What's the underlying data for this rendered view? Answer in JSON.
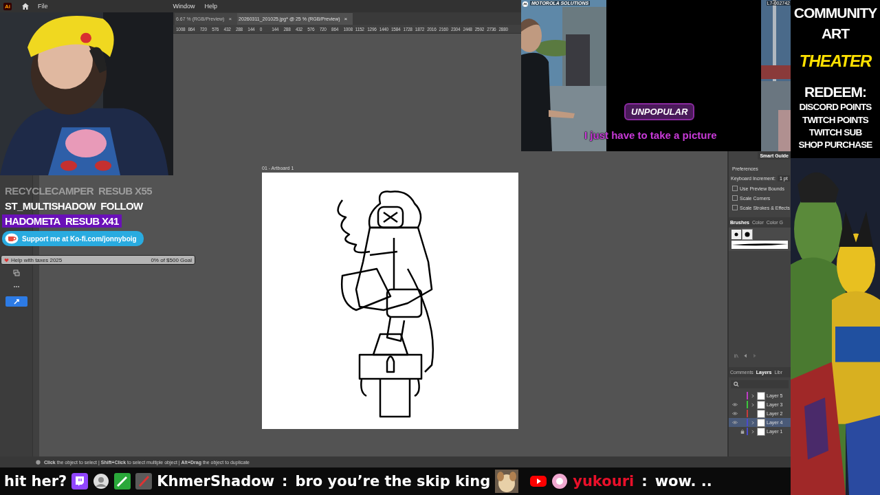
{
  "app": {
    "logo": "Ai",
    "menu": [
      "File",
      "Window",
      "Help"
    ]
  },
  "tabs": [
    {
      "label": "6.67 % (RGB/Preview)",
      "close": "×",
      "selected": false
    },
    {
      "label": "20260311_201025.jpg* @ 25 % (RGB/Preview)",
      "close": "×",
      "selected": true
    }
  ],
  "ruler": [
    "1008",
    "864",
    "720",
    "576",
    "432",
    "288",
    "144",
    "0",
    "144",
    "288",
    "432",
    "576",
    "720",
    "864",
    "1008",
    "1152",
    "1296",
    "1440",
    "1584",
    "1728",
    "1872",
    "2016",
    "2160",
    "2304",
    "2448",
    "2592",
    "2736",
    "2880"
  ],
  "artboard": {
    "label": "01 - Artboard 1"
  },
  "status_bar": {
    "text": "**Click** the object to select  |  **Shift+Click** to select multiple object  |  **Alt+Drag** the object to duplicate"
  },
  "properties": {
    "smart_guides": "Smart Guide",
    "section": "Preferences",
    "increment_label": "Keyboard Increment:",
    "increment_value": "1 pt",
    "options": [
      {
        "label": "Use Preview Bounds",
        "checked": false
      },
      {
        "label": "Scale Corners",
        "checked": false
      },
      {
        "label": "Scale Strokes & Effects",
        "checked": false
      }
    ]
  },
  "brush_tabs": [
    {
      "label": "Brushes",
      "selected": true
    },
    {
      "label": "Color",
      "selected": false
    },
    {
      "label": "Color G",
      "selected": false
    }
  ],
  "layer_tabs": [
    {
      "label": "Comments",
      "selected": false
    },
    {
      "label": "Layers",
      "selected": true
    },
    {
      "label": "Libr",
      "selected": false
    }
  ],
  "layers": [
    {
      "name": "Layer 5",
      "color": "#c03cc8",
      "visible": false,
      "locked": false,
      "expandable": true,
      "selected": false
    },
    {
      "name": "Layer 3",
      "color": "#3cc83c",
      "visible": true,
      "locked": false,
      "expandable": true,
      "selected": false
    },
    {
      "name": "Layer 2",
      "color": "#c83c3c",
      "visible": true,
      "locked": false,
      "expandable": false,
      "selected": false
    },
    {
      "name": "Layer 4",
      "color": "#4a4ad0",
      "visible": true,
      "locked": false,
      "expandable": true,
      "selected": true
    },
    {
      "name": "Layer 1",
      "color": "#4a4ad0",
      "visible": false,
      "locked": true,
      "expandable": true,
      "selected": false
    }
  ],
  "alerts": [
    {
      "user": "RECYCLECAMPER",
      "event": "RESUB X55",
      "faded": true,
      "highlighted": false
    },
    {
      "user": "ST_MULTISHADOW",
      "event": "FOLLOW",
      "faded": false,
      "highlighted": false
    },
    {
      "user": "HADOMETA",
      "event": "RESUB X41",
      "faded": false,
      "highlighted": true
    }
  ],
  "kofi": {
    "text": "Support me at Ko-fi.com/jonnyboig"
  },
  "goal": {
    "title": "Help with taxes 2025",
    "progress": "0% of $500 Goal",
    "level": 0
  },
  "video": {
    "brand": "MOTOROLA SOLUTIONS",
    "code": "L7-002742",
    "logo": "UNPOPULAR",
    "caption": "I just have to take a picture"
  },
  "sidebar": {
    "lines": [
      {
        "text": "COMMUNITY",
        "kind": "plain"
      },
      {
        "text": "ART",
        "kind": "plain"
      },
      {
        "text": "THEATER",
        "kind": "accent"
      },
      {
        "text": "REDEEM:",
        "kind": "plain"
      },
      {
        "text": "DISCORD POINTS",
        "kind": "small"
      },
      {
        "text": "TWITCH POINTS",
        "kind": "small"
      },
      {
        "text": "TWITCH SUB",
        "kind": "small"
      },
      {
        "text": "SHOP PURCHASE",
        "kind": "small"
      }
    ]
  },
  "chat": [
    {
      "kind": "fragment",
      "text": "hit her?"
    },
    {
      "kind": "twitch",
      "user": "KhmerShadow",
      "color": "#ffffff",
      "separator": ":",
      "text": "bro you’re the skip king",
      "emote": true
    },
    {
      "kind": "youtube",
      "user": "yukouri",
      "color": "#e8102a",
      "separator": ":",
      "text": "wow. ..",
      "emote": false
    }
  ]
}
